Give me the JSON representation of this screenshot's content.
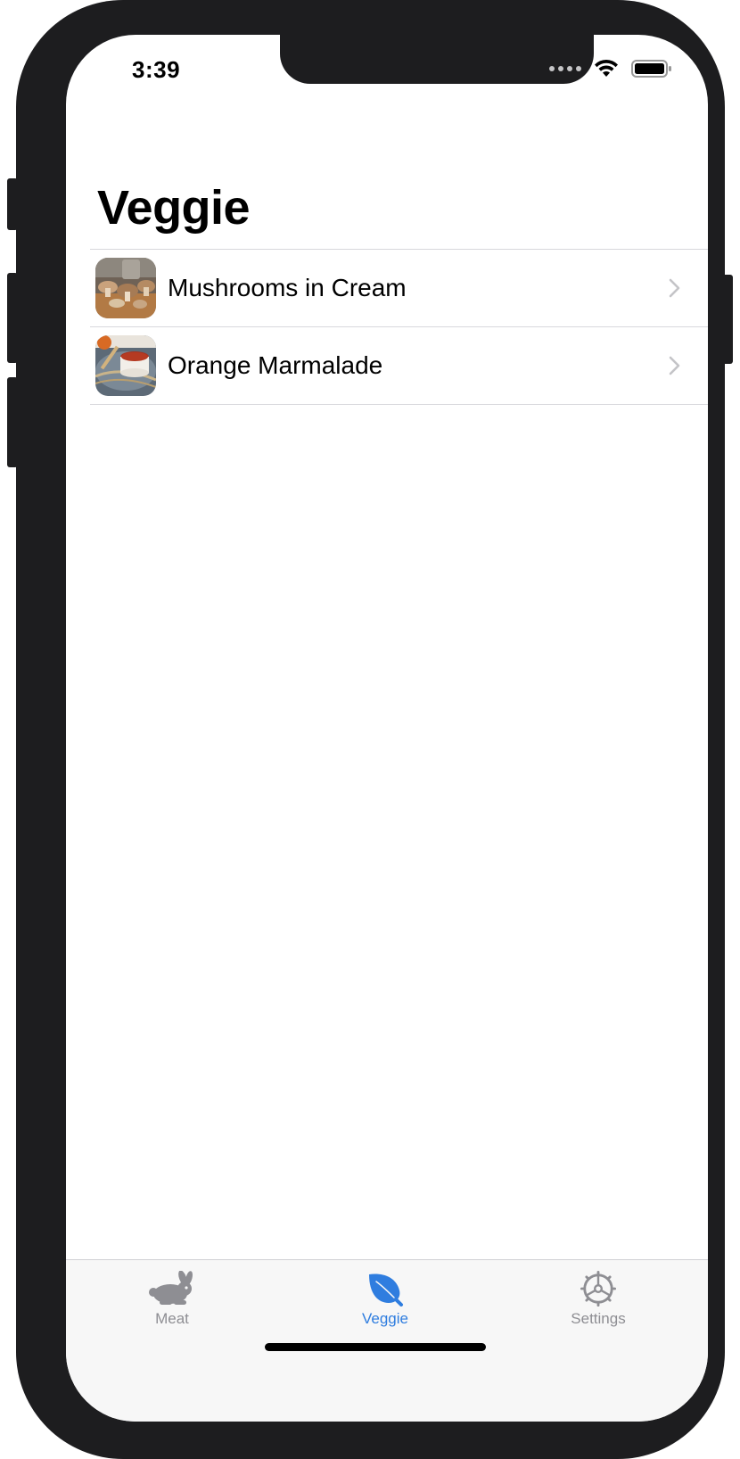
{
  "status_bar": {
    "time": "3:39"
  },
  "page": {
    "title": "Veggie"
  },
  "list": {
    "items": [
      {
        "label": "Mushrooms in Cream",
        "thumbnail": "mushrooms-photo"
      },
      {
        "label": "Orange Marmalade",
        "thumbnail": "marmalade-photo"
      }
    ]
  },
  "tabbar": {
    "tabs": [
      {
        "label": "Meat",
        "icon": "rabbit-icon",
        "selected": false
      },
      {
        "label": "Veggie",
        "icon": "leaf-icon",
        "selected": true
      },
      {
        "label": "Settings",
        "icon": "gear-icon",
        "selected": false
      }
    ]
  },
  "colors": {
    "accent": "#2f7ddf",
    "inactive": "#8e8e93"
  }
}
